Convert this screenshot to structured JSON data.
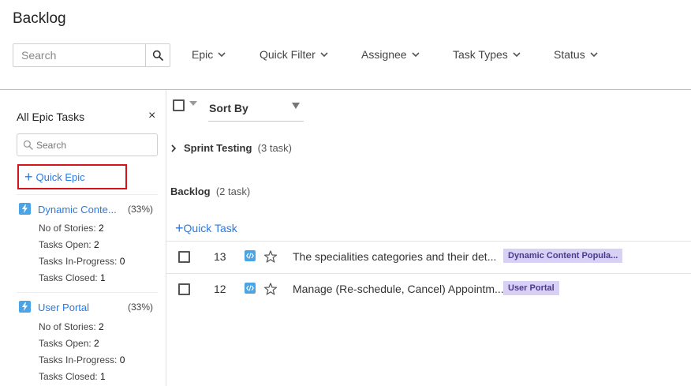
{
  "header": {
    "title": "Backlog",
    "search_placeholder": "Search",
    "filters": [
      "Epic",
      "Quick Filter",
      "Assignee",
      "Task Types",
      "Status"
    ]
  },
  "sidebar": {
    "title": "All Epic Tasks",
    "close": "×",
    "search_placeholder": "Search",
    "quick_epic_label": "Quick Epic",
    "epics": [
      {
        "name": "Dynamic Conte...",
        "percent": "(33%)",
        "stats": [
          {
            "label": "No of Stories:",
            "value": "2"
          },
          {
            "label": "Tasks Open:",
            "value": "2"
          },
          {
            "label": "Tasks In-Progress:",
            "value": "0"
          },
          {
            "label": "Tasks Closed:",
            "value": "1"
          }
        ]
      },
      {
        "name": "User Portal",
        "percent": "(33%)",
        "stats": [
          {
            "label": "No of Stories:",
            "value": "2"
          },
          {
            "label": "Tasks Open:",
            "value": "2"
          },
          {
            "label": "Tasks In-Progress:",
            "value": "0"
          },
          {
            "label": "Tasks Closed:",
            "value": "1"
          }
        ]
      }
    ]
  },
  "main": {
    "sort_label": "Sort By",
    "sprint": {
      "name": "Sprint Testing",
      "count": "(3 task)"
    },
    "backlog": {
      "name": "Backlog",
      "count": "(2 task)"
    },
    "quick_task_label": "Quick Task",
    "tasks": [
      {
        "id": "13",
        "title": "The specialities categories and their det...",
        "tag": "Dynamic Content Popula..."
      },
      {
        "id": "12",
        "title": "Manage (Re-schedule, Cancel) Appointm...",
        "tag": "User Portal"
      }
    ]
  },
  "colors": {
    "accent": "#2a7ae2",
    "tag_bg": "#d9d0f6",
    "highlight_border": "#d3141b"
  },
  "icons": {
    "search": "search-icon",
    "chevron": "chevron-down-icon",
    "epic": "lightning-icon",
    "task_type": "code-icon",
    "star": "star-icon"
  }
}
